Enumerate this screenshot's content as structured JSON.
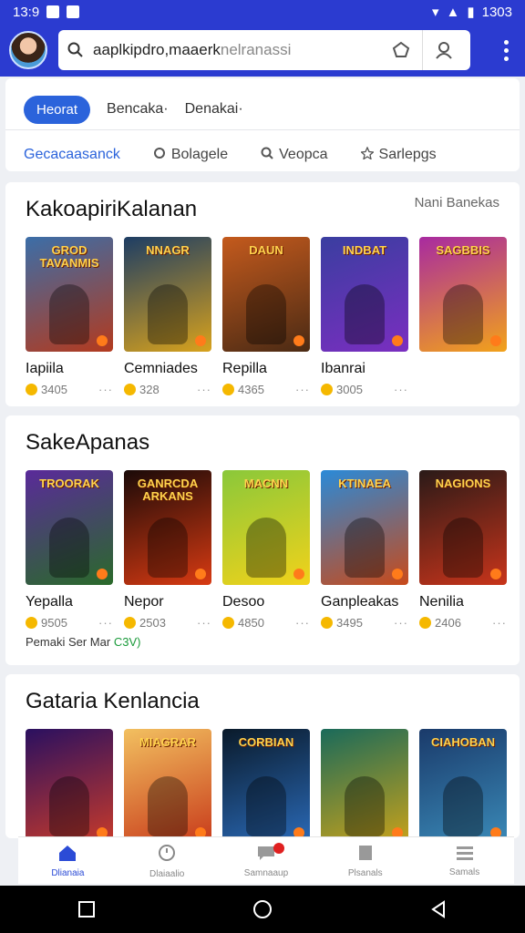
{
  "status": {
    "time": "13:9",
    "battery": "1303"
  },
  "search": {
    "query": "aaplkipdro,maaer",
    "query_cont": "k",
    "hint": "nelranassi"
  },
  "chips": [
    {
      "label": "Heorat",
      "active": true
    },
    {
      "label": "Bencaka·",
      "active": false
    },
    {
      "label": "Denakai·",
      "active": false
    }
  ],
  "tabs": [
    {
      "label": "Gecacaasanck",
      "icon": "none",
      "active": true
    },
    {
      "label": "Bolagele",
      "icon": "gear-icon",
      "active": false
    },
    {
      "label": "Veopca",
      "icon": "search-icon",
      "active": false
    },
    {
      "label": "Sarlepgs",
      "icon": "star-icon",
      "active": false
    }
  ],
  "sections": [
    {
      "title": "KakoapiriKalanan",
      "more": "Nani Banekas",
      "note": "",
      "items": [
        {
          "name": "Iapiila",
          "rating": "3405",
          "logo": "GROD TAVANMIS",
          "c1": "#3b6ea8",
          "c2": "#b33a1e"
        },
        {
          "name": "Cemniades",
          "rating": "328",
          "logo": "NNAGR",
          "c1": "#1d3d64",
          "c2": "#d8a21c"
        },
        {
          "name": "Repilla",
          "rating": "4365",
          "logo": "DAUN",
          "c1": "#c45a1d",
          "c2": "#4a2a14"
        },
        {
          "name": "Ibanrai",
          "rating": "3005",
          "logo": "INDBAT",
          "c1": "#3a3ea0",
          "c2": "#7a2ec0"
        },
        {
          "name": "",
          "rating": "",
          "logo": "SAGBBIS",
          "c1": "#a82aa0",
          "c2": "#f2a21a"
        }
      ]
    },
    {
      "title": "SakeApanas",
      "more": "",
      "note_label": "Pemaki Ser Mar",
      "note_value": "C3V)",
      "items": [
        {
          "name": "Yepalla",
          "rating": "9505",
          "logo": "TROORAK",
          "c1": "#5a2a9a",
          "c2": "#2a6a2a"
        },
        {
          "name": "Nepor",
          "rating": "2503",
          "logo": "GANRCDA ARKANS",
          "c1": "#1a0a08",
          "c2": "#d83a12"
        },
        {
          "name": "Desoo",
          "rating": "4850",
          "logo": "MACNN",
          "c1": "#8ac83a",
          "c2": "#f2d21a"
        },
        {
          "name": "Ganpleakas",
          "rating": "3495",
          "logo": "KTINAEA",
          "c1": "#2a8ad8",
          "c2": "#c84a1a"
        },
        {
          "name": "Nenilia",
          "rating": "2406",
          "logo": "NAGIONS",
          "c1": "#2a1a18",
          "c2": "#c8341a"
        }
      ]
    },
    {
      "title": "Gataria Kenlancia",
      "more": "",
      "note": "",
      "items": [
        {
          "name": "",
          "rating": "",
          "logo": "",
          "c1": "#2a1060",
          "c2": "#c83a2a"
        },
        {
          "name": "",
          "rating": "",
          "logo": "MIAGRAR",
          "c1": "#f2c060",
          "c2": "#c83a1a"
        },
        {
          "name": "",
          "rating": "",
          "logo": "CORBIAN",
          "c1": "#0a1a2a",
          "c2": "#2a6ab8"
        },
        {
          "name": "",
          "rating": "",
          "logo": "",
          "c1": "#1a6a5a",
          "c2": "#c8a21a"
        },
        {
          "name": "",
          "rating": "",
          "logo": "CIAHOBAN",
          "c1": "#1a3a6a",
          "c2": "#3a8ab8"
        }
      ]
    }
  ],
  "nav": [
    {
      "label": "Dlianaia",
      "icon": "home-icon",
      "active": true
    },
    {
      "label": "Dlaiaalio",
      "icon": "clock-icon",
      "active": false
    },
    {
      "label": "Samnaaup",
      "icon": "chat-icon",
      "active": false
    },
    {
      "label": "Plsanals",
      "icon": "library-icon",
      "active": false
    },
    {
      "label": "Samals",
      "icon": "menu-icon",
      "active": false
    }
  ]
}
